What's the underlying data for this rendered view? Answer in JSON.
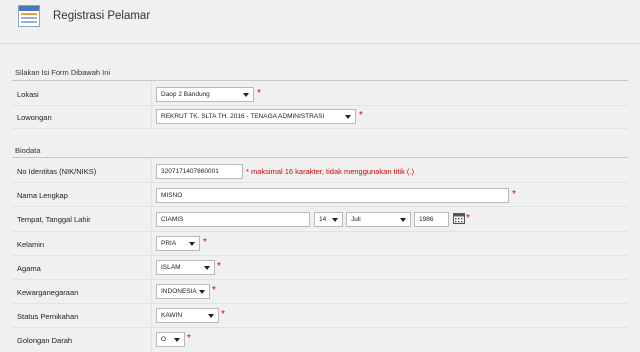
{
  "header": {
    "title": "Registrasi Pelamar",
    "icon": "form-document-icon"
  },
  "section1": {
    "title": "Silakan Isi Form Dibawah Ini"
  },
  "lokasi": {
    "label": "Lokasi",
    "value": "Daop 2 Bandung"
  },
  "lowongan": {
    "label": "Lowongan",
    "value": "REKRUT TK. SLTA TH. 2016 - TENAGA ADMINISTRASI"
  },
  "section2": {
    "title": "Biodata"
  },
  "nik": {
    "label": "No Identitas (NIK/NIKS)",
    "value": "3207171407860001",
    "hint": "* maksimal 16 karakter, tidak menggunakan titik (.)"
  },
  "nama": {
    "label": "Nama Lengkap",
    "value": "MISNO"
  },
  "ttl": {
    "label": "Tempat, Tanggal Lahir",
    "tempat": "CIAMIS",
    "tanggal": "14",
    "bulan": "Juli",
    "tahun": "1986"
  },
  "kelamin": {
    "label": "Kelamin",
    "value": "PRIA"
  },
  "agama": {
    "label": "Agama",
    "value": "ISLAM"
  },
  "kewarganegaraan": {
    "label": "Kewarganegaraan",
    "value": "INDONESIA"
  },
  "status": {
    "label": "Status Pernikahan",
    "value": "KAWIN"
  },
  "golongan": {
    "label": "Golongan Darah",
    "value": "O"
  },
  "required_mark": "*",
  "colors": {
    "required": "#e00000",
    "background": "#f0f0f0",
    "field_border": "#b8b8b8"
  }
}
